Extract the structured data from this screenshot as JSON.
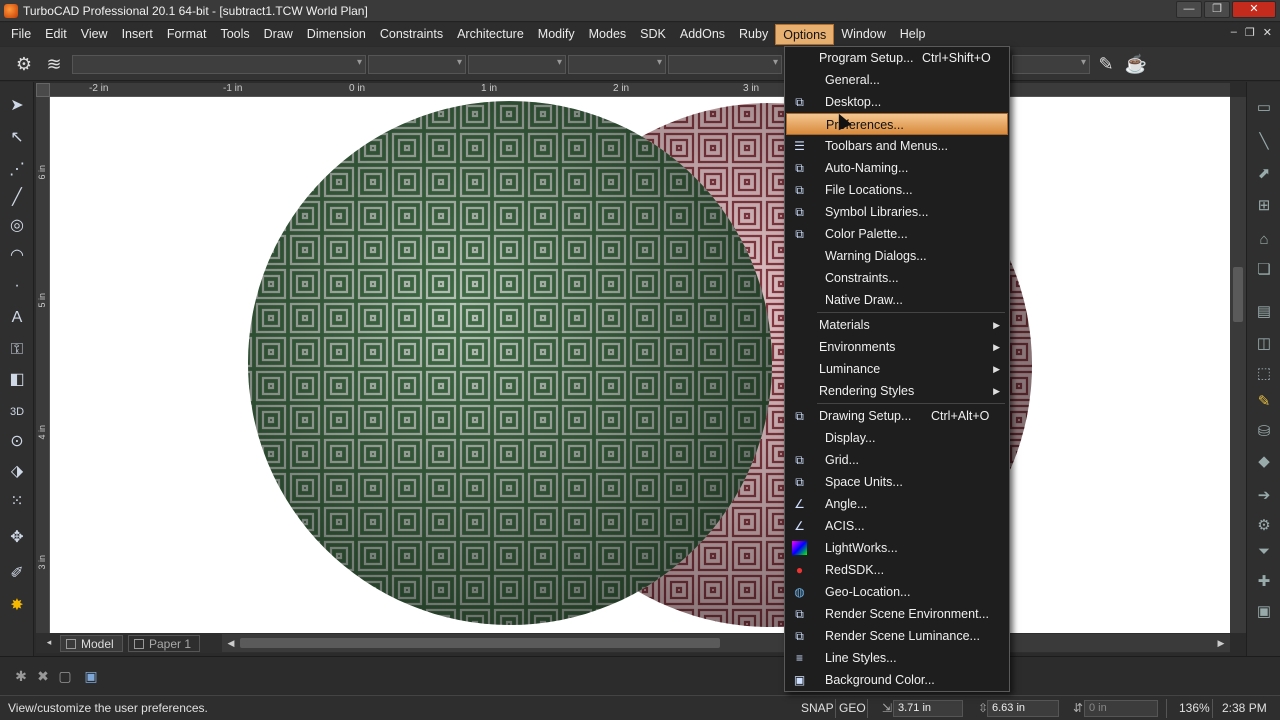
{
  "window": {
    "title": "TurboCAD Professional 20.1 64-bit - [subtract1.TCW World Plan]",
    "minimize": "—",
    "restore": "❐",
    "close": "✕"
  },
  "menubar": {
    "items": [
      "File",
      "Edit",
      "View",
      "Insert",
      "Format",
      "Tools",
      "Draw",
      "Dimension",
      "Constraints",
      "Architecture",
      "Modify",
      "Modes",
      "SDK",
      "AddOns",
      "Ruby",
      "Options",
      "Window",
      "Help"
    ],
    "active": "Options",
    "doc_controls": [
      "–",
      "❐",
      "✕"
    ]
  },
  "ruler": {
    "h_labels": [
      "-2 in",
      "-1 in",
      "0 in",
      "1 in",
      "2 in",
      "3 in"
    ],
    "v_labels": [
      "6 in",
      "5 in",
      "4 in",
      "3 in"
    ]
  },
  "tabs": {
    "model": "Model",
    "paper": "Paper 1"
  },
  "options_menu": {
    "items": [
      {
        "label": "Program Setup...",
        "shortcut": "Ctrl+Shift+O",
        "icon": "none",
        "indent": false
      },
      {
        "label": "General...",
        "icon": "none",
        "indent": true
      },
      {
        "label": "Desktop...",
        "icon": "desktop-setup-icon",
        "indent": true
      },
      {
        "label": "Preferences...",
        "icon": "none",
        "indent": true,
        "highlighted": true
      },
      {
        "label": "Toolbars and Menus...",
        "icon": "toolbars-icon",
        "indent": true
      },
      {
        "label": "Auto-Naming...",
        "icon": "auto-naming-icon",
        "indent": true
      },
      {
        "label": "File Locations...",
        "icon": "file-locations-icon",
        "indent": true
      },
      {
        "label": "Symbol Libraries...",
        "icon": "symbol-libraries-icon",
        "indent": true
      },
      {
        "label": "Color Palette...",
        "icon": "color-palette-icon",
        "indent": true
      },
      {
        "label": "Warning Dialogs...",
        "icon": "none",
        "indent": true
      },
      {
        "label": "Constraints...",
        "icon": "none",
        "indent": true
      },
      {
        "label": "Native Draw...",
        "icon": "none",
        "indent": true
      },
      {
        "label": "Materials",
        "submenu": true,
        "icon": "none",
        "indent": false
      },
      {
        "label": "Environments",
        "submenu": true,
        "icon": "none",
        "indent": false
      },
      {
        "label": "Luminance",
        "submenu": true,
        "icon": "none",
        "indent": false
      },
      {
        "label": "Rendering Styles",
        "submenu": true,
        "icon": "none",
        "indent": false
      },
      {
        "label": "Drawing Setup...",
        "shortcut": "Ctrl+Alt+O",
        "icon": "drawing-setup-icon",
        "indent": false
      },
      {
        "label": "Display...",
        "icon": "none",
        "indent": true
      },
      {
        "label": "Grid...",
        "icon": "grid-icon",
        "indent": true
      },
      {
        "label": "Space Units...",
        "icon": "space-units-icon",
        "indent": true
      },
      {
        "label": "Angle...",
        "icon": "angle-icon",
        "indent": true
      },
      {
        "label": "ACIS...",
        "icon": "acis-icon",
        "indent": true
      },
      {
        "label": "LightWorks...",
        "icon": "lightworks-icon",
        "indent": true
      },
      {
        "label": "RedSDK...",
        "icon": "redsdk-icon",
        "indent": true
      },
      {
        "label": "Geo-Location...",
        "icon": "geo-location-icon",
        "indent": true
      },
      {
        "label": "Render Scene Environment...",
        "icon": "render-env-icon",
        "indent": true
      },
      {
        "label": "Render Scene Luminance...",
        "icon": "render-lum-icon",
        "indent": true
      },
      {
        "label": "Line Styles...",
        "icon": "line-styles-icon",
        "indent": true
      },
      {
        "label": "Background Color...",
        "icon": "background-color-icon",
        "indent": true
      }
    ]
  },
  "status": {
    "message": "View/customize the user preferences.",
    "snap": "SNAP",
    "geo": "GEO",
    "x": "3.71 in",
    "y": "6.63 in",
    "z": "0 in",
    "zoom": "136%",
    "time": "2:38 PM"
  },
  "colors": {
    "highlight": "#e8b070",
    "sphere_left": "#3f6b45",
    "sphere_right": "#c99096"
  }
}
